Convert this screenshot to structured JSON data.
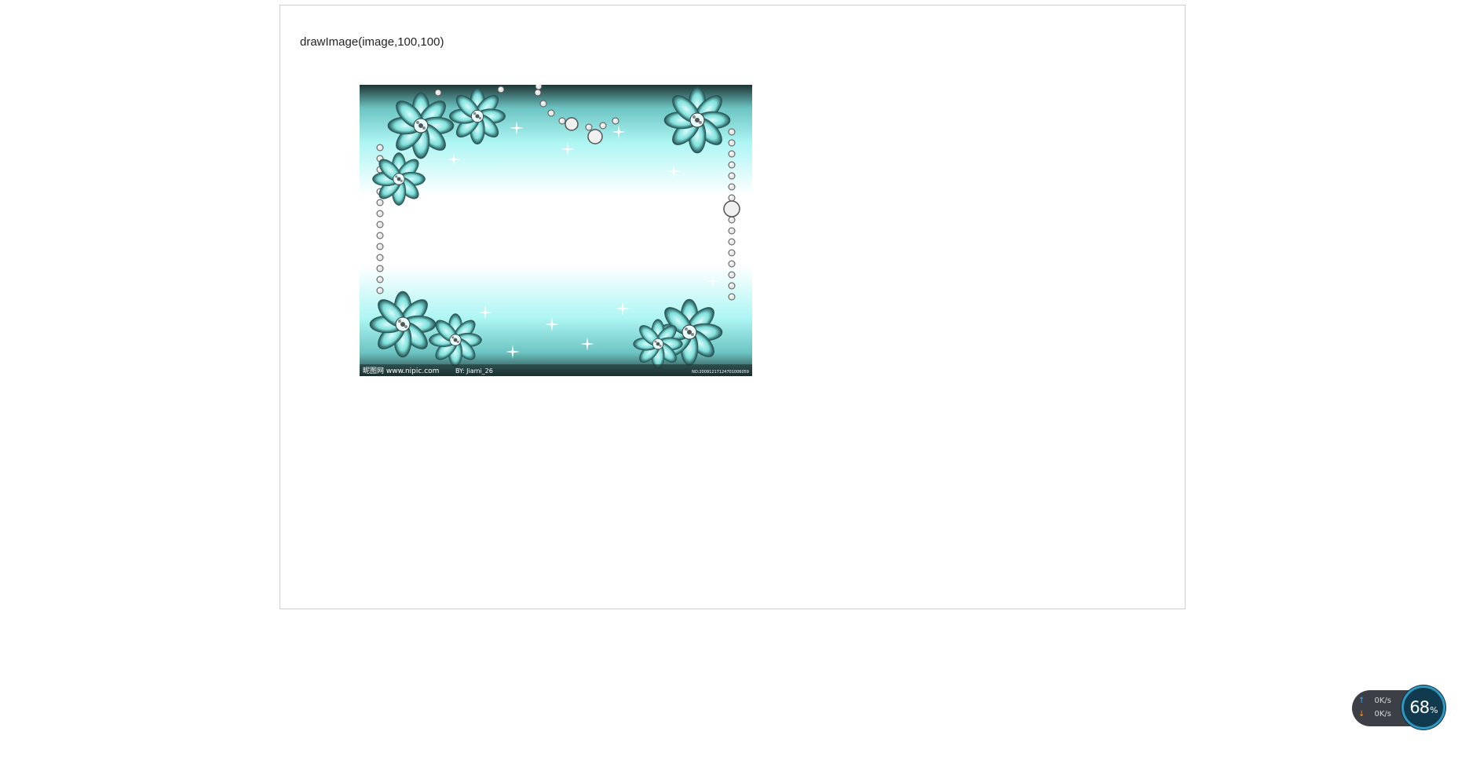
{
  "caption": "drawImage(image,100,100)",
  "image": {
    "footer_left": "昵图网 www.nipic.com",
    "footer_by": "BY: Jiami_26",
    "footer_right": "NO:20091217124701006059",
    "colors": {
      "cyan": "#9ff5f2",
      "dark": "#1a2a2a",
      "white": "#ffffff"
    }
  },
  "net_monitor": {
    "upload_arrow": "↑",
    "download_arrow": "↓",
    "upload": "0K/s",
    "download": "0K/s",
    "percent": "68",
    "percent_sign": "%",
    "colors": {
      "upload": "#3aa7e6",
      "download": "#f39a1f",
      "ring": "#2f98c0"
    }
  }
}
